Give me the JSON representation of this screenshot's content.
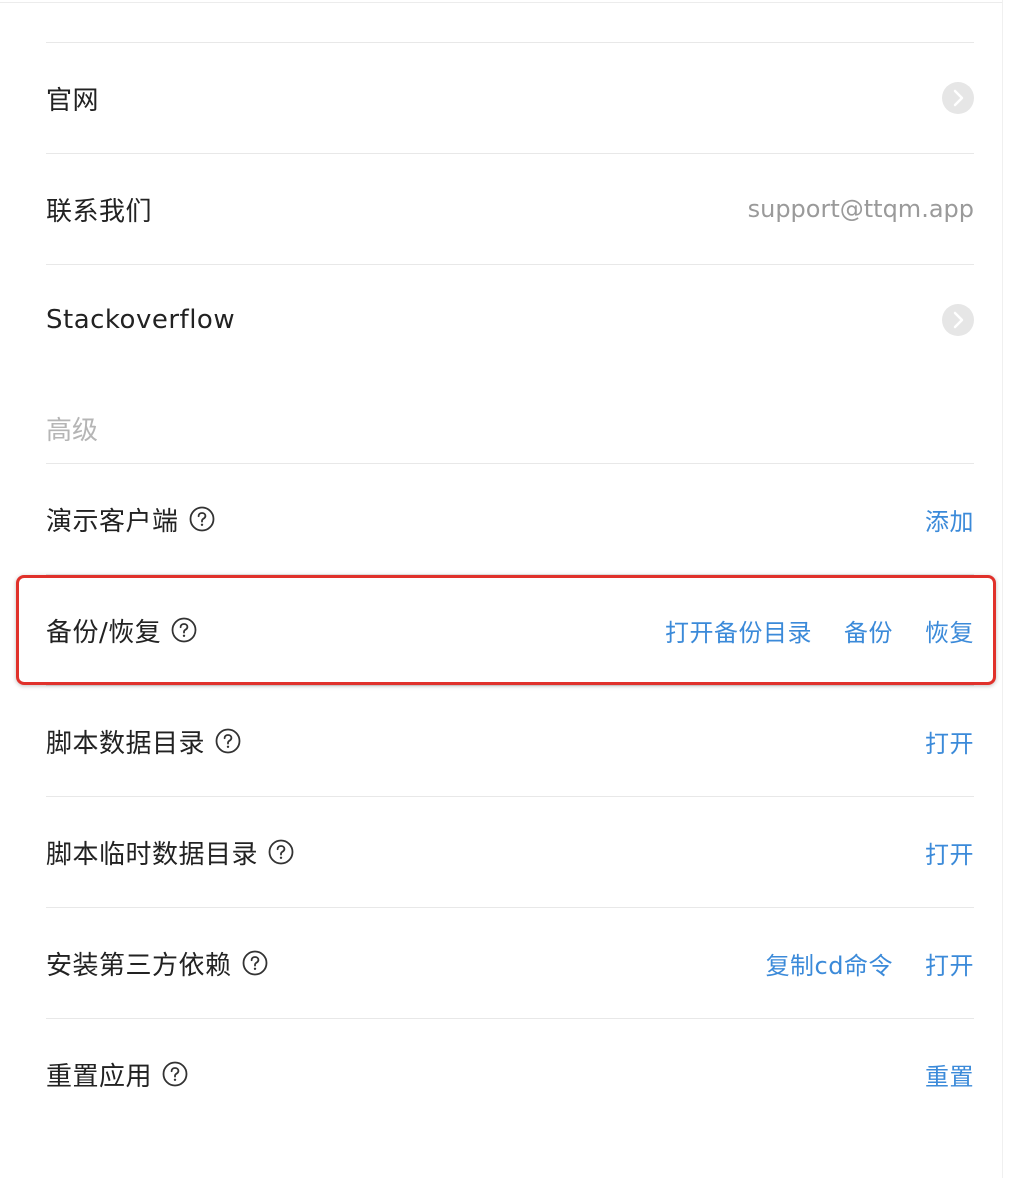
{
  "about": {
    "website_label": "官网",
    "contact_label": "联系我们",
    "contact_email": "support@ttqm.app",
    "stackoverflow_label": "Stackoverflow"
  },
  "advanced": {
    "section_title": "高级",
    "demo_client": {
      "label": "演示客户端",
      "action_add": "添加"
    },
    "backup_restore": {
      "label": "备份/恢复",
      "action_open_dir": "打开备份目录",
      "action_backup": "备份",
      "action_restore": "恢复"
    },
    "script_data_dir": {
      "label": "脚本数据目录",
      "action_open": "打开"
    },
    "script_temp_data_dir": {
      "label": "脚本临时数据目录",
      "action_open": "打开"
    },
    "install_deps": {
      "label": "安装第三方依赖",
      "action_copy_cd": "复制cd命令",
      "action_open": "打开"
    },
    "reset_app": {
      "label": "重置应用",
      "action_reset": "重置"
    }
  },
  "colors": {
    "link": "#3b8ad9",
    "highlight": "#e0312b",
    "muted": "#9a9a9a"
  }
}
